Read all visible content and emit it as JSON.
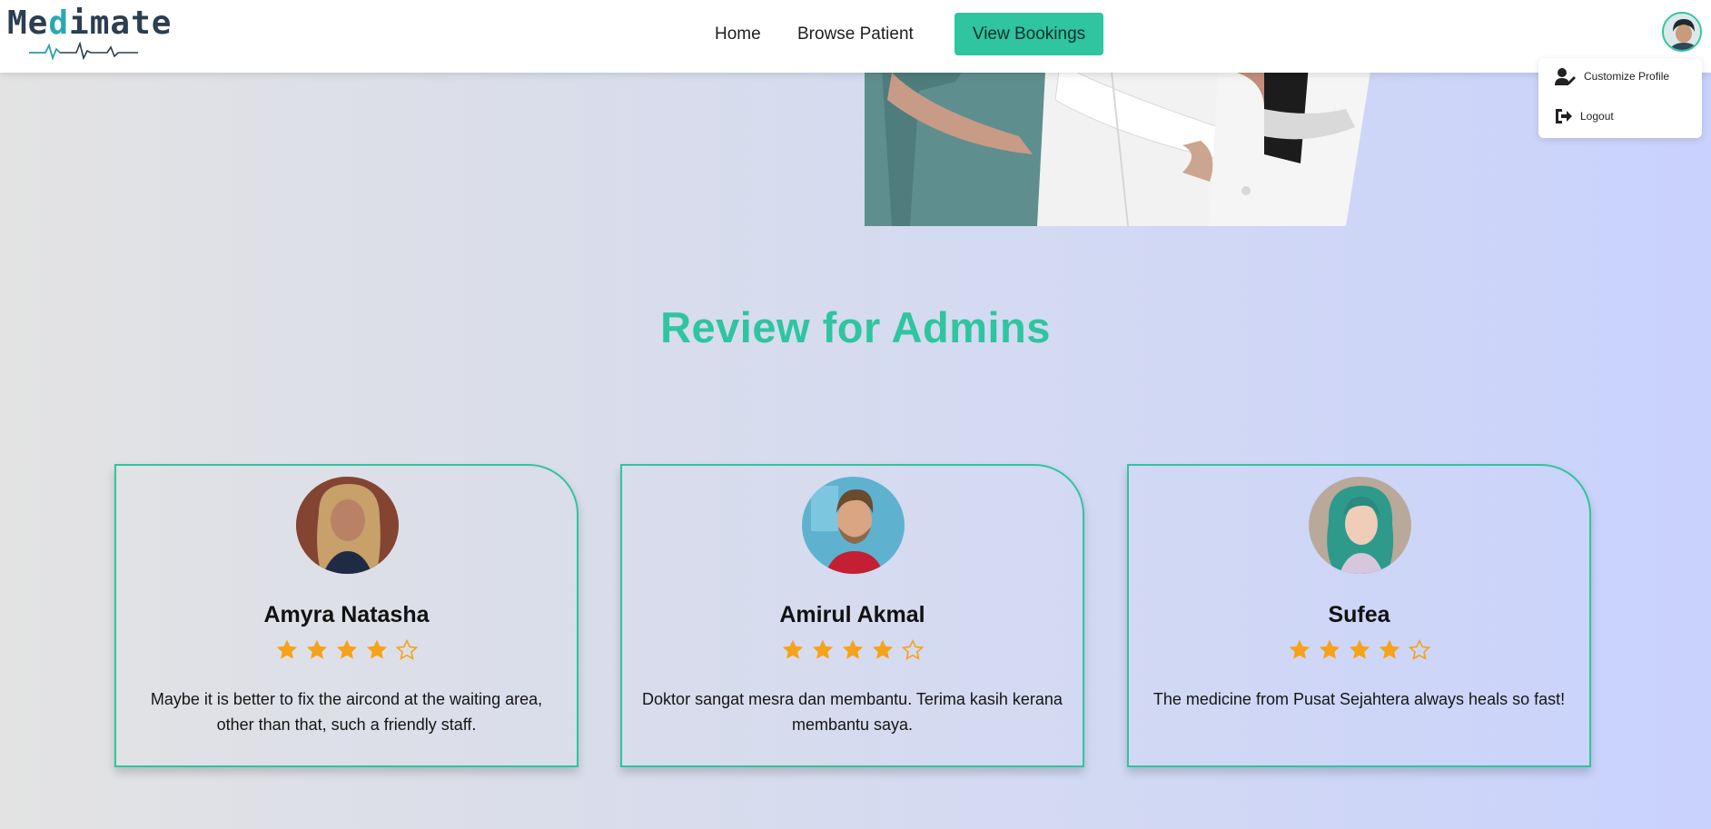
{
  "brand": {
    "name_part1": "Me",
    "name_highlight": "d",
    "name_part2": "imate"
  },
  "nav": {
    "home": "Home",
    "browse_patient": "Browse Patient",
    "view_bookings": "View Bookings"
  },
  "profile_menu": {
    "customize_profile": "Customize Profile",
    "logout": "Logout"
  },
  "section": {
    "title": "Review for Admins"
  },
  "reviews": [
    {
      "name": "Amyra Natasha",
      "rating": 4,
      "max_rating": 5,
      "text": "Maybe it is better to fix the aircond at the waiting area, other than that, such a friendly staff."
    },
    {
      "name": "Amirul Akmal",
      "rating": 4,
      "max_rating": 5,
      "text": "Doktor sangat mesra dan membantu. Terima kasih kerana membantu saya."
    },
    {
      "name": "Sufea",
      "rating": 4,
      "max_rating": 5,
      "text": "The medicine from Pusat Sejahtera always heals so fast!"
    }
  ],
  "colors": {
    "accent": "#2ec5a0",
    "star": "#f6a21a",
    "text": "#151515"
  }
}
